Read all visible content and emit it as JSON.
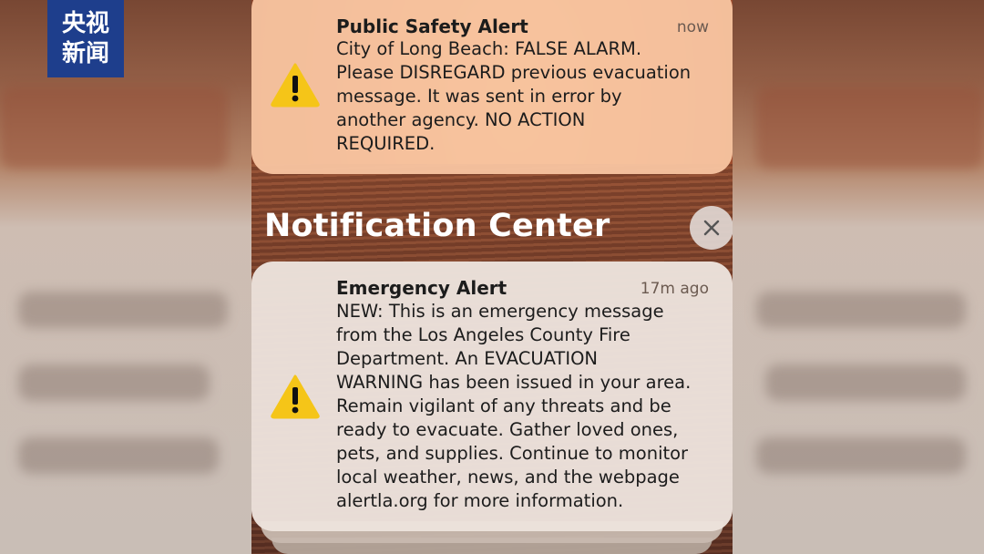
{
  "watermark": {
    "line1": "央视",
    "line2": "新闻"
  },
  "notification_center": {
    "title": "Notification Center",
    "close_icon": "close-icon"
  },
  "alerts": [
    {
      "title": "Public Safety Alert",
      "time": "now",
      "icon": "warning-icon",
      "body": "City of Long Beach: FALSE ALARM.\nPlease DISREGARD previous evacuation\nmessage. It was sent in error by\nanother agency. NO ACTION\nREQUIRED."
    },
    {
      "title": "Emergency Alert",
      "time": "17m ago",
      "icon": "warning-icon",
      "body": "NEW: This is an emergency message\nfrom the Los Angeles County Fire\nDepartment. An EVACUATION\nWARNING has been issued in your area.\nRemain vigilant of any threats and be\nready to evacuate. Gather loved ones,\npets, and supplies. Continue to monitor\nlocal weather, news, and the webpage\nalertla.org for more information."
    }
  ],
  "colors": {
    "warning_fill": "#f5c518",
    "logo_bg": "#1e3e8c"
  }
}
